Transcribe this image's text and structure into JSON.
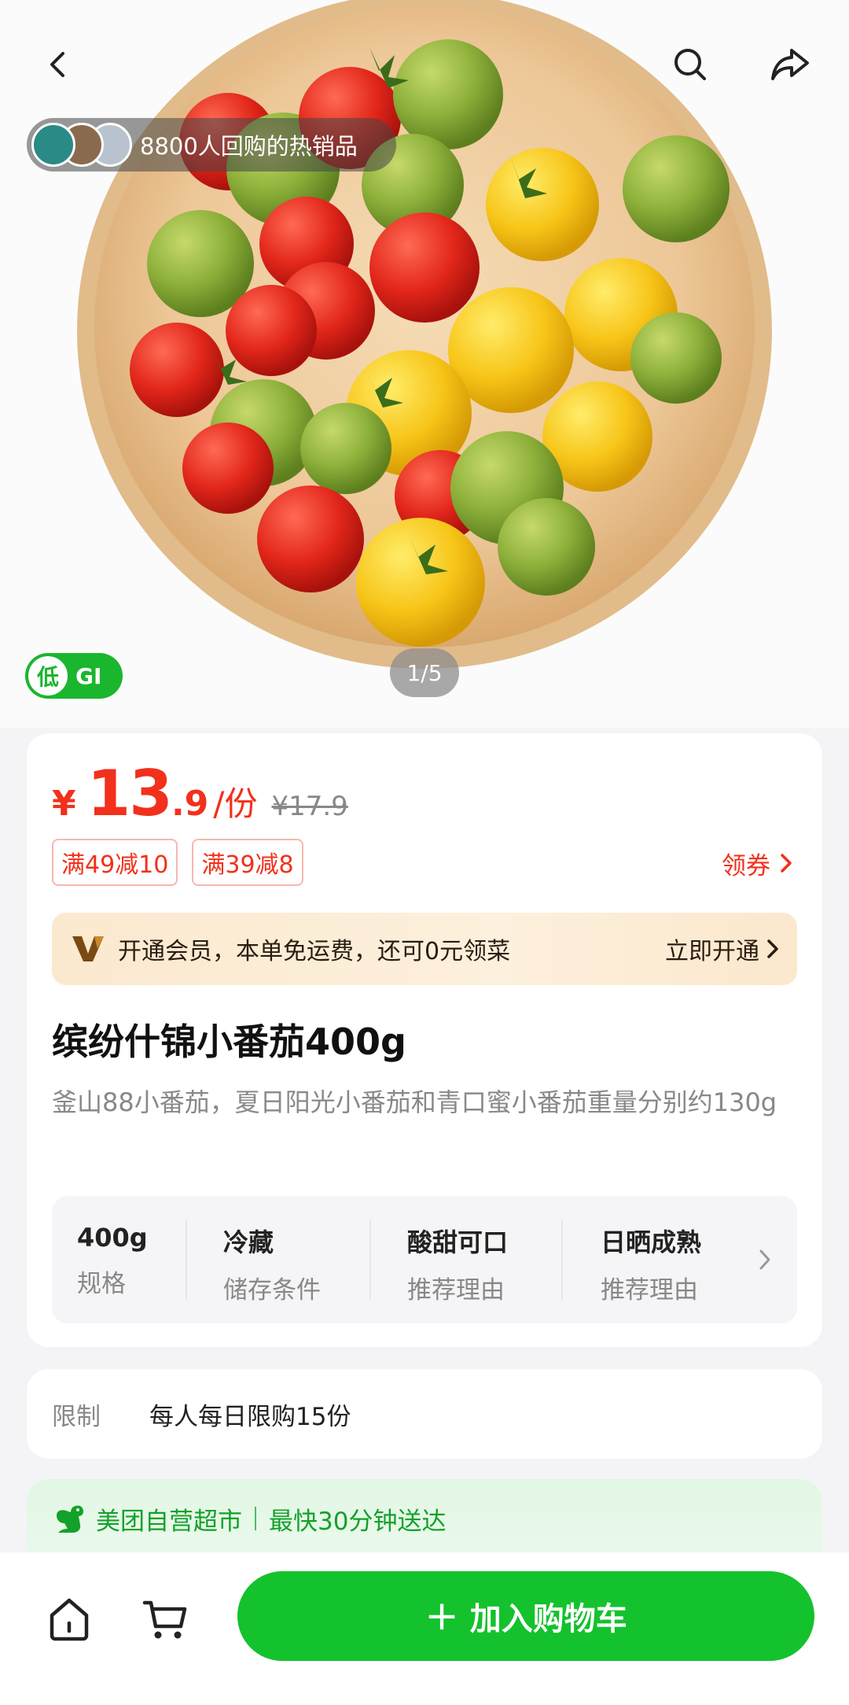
{
  "hero": {
    "repurchase_text": "8800人回购的热销品",
    "gi_low": "低",
    "gi_text": "GI",
    "page_indicator": "1/5"
  },
  "price": {
    "currency": "¥",
    "integer": "13",
    "decimal": ".9",
    "unit": "/份",
    "original": "¥17.9"
  },
  "coupons": [
    "满49减10",
    "满39减8"
  ],
  "get_coupon_label": "领券",
  "member": {
    "text": "开通会员，本单免运费，还可0元领菜",
    "action": "立即开通"
  },
  "product": {
    "title": "缤纷什锦小番茄400g",
    "subtitle": "釜山88小番茄，夏日阳光小番茄和青口蜜小番茄重量分别约130g"
  },
  "specs": [
    {
      "value": "400g",
      "label": "规格"
    },
    {
      "value": "冷藏",
      "label": "储存条件"
    },
    {
      "value": "酸甜可口",
      "label": "推荐理由"
    },
    {
      "value": "日晒成熟",
      "label": "推荐理由"
    }
  ],
  "limit": {
    "label": "限制",
    "text": "每人每日限购15份"
  },
  "delivery": {
    "store": "美团自营超市",
    "speed": "最快30分钟送达"
  },
  "bottom": {
    "add_to_cart": "加入购物车"
  },
  "colors": {
    "price_red": "#f2301b",
    "brand_green": "#14c22d",
    "delivery_green": "#13a12a"
  }
}
